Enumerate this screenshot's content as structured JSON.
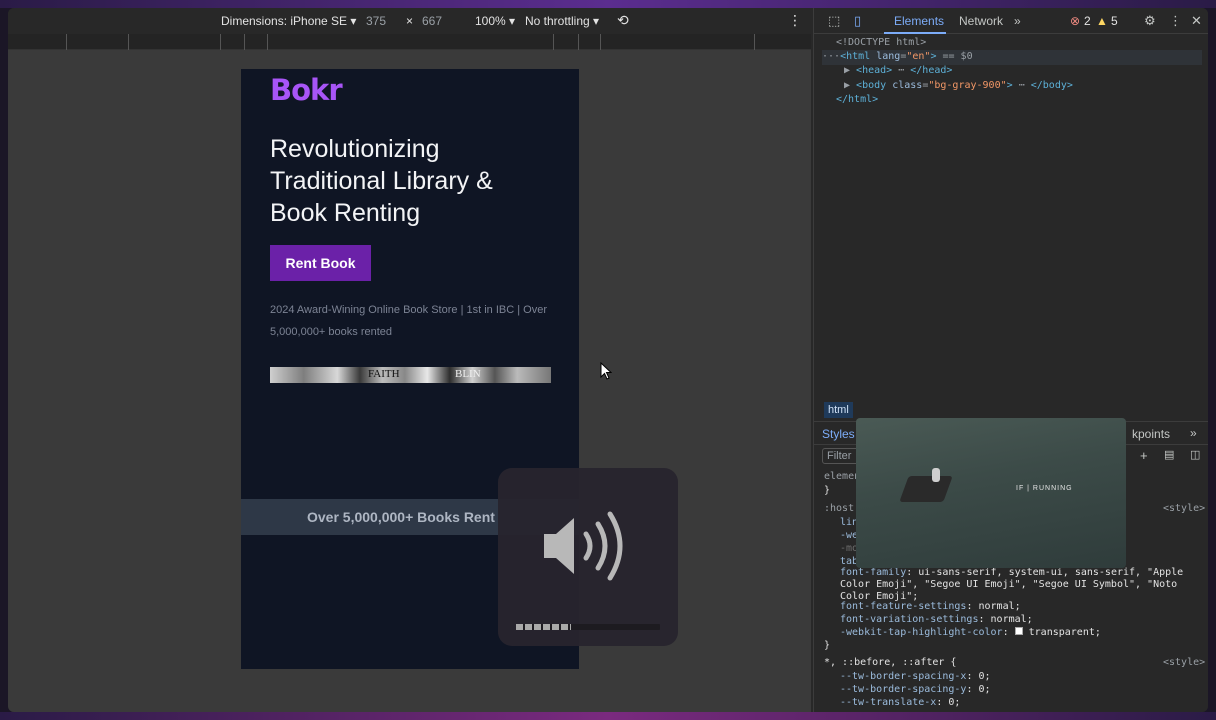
{
  "device_toolbar": {
    "dimensions_label": "Dimensions: iPhone SE",
    "width": "375",
    "times": "×",
    "height": "667",
    "zoom": "100%",
    "throttling": "No throttling"
  },
  "site": {
    "logo": "Bokr",
    "headline": "Revolutionizing Traditional Library & Book Renting",
    "cta_label": "Rent Book",
    "awards_text": "2024 Award-Wining Online Book Store  |  1st in IBC  |  Over 5,000,000+ books rented",
    "book_strip_text_1": "FAITH",
    "book_strip_text_2": "BLIN",
    "banner_text": "Over 5,000,000+ Books Rent"
  },
  "devtools": {
    "tabs": [
      "Elements",
      "Network"
    ],
    "more": "»",
    "error_count": "2",
    "warning_count": "5",
    "dom": {
      "doctype": "<!DOCTYPE html>",
      "html_open_tag": "html",
      "html_attr_name": "lang",
      "html_attr_value": "\"en\"",
      "selected_marker": " == $0",
      "head_line": "<head>",
      "head_close": "</head>",
      "body_tag": "body",
      "body_attr_name": "class",
      "body_attr_value": "\"bg-gray-900\"",
      "body_close": "</body>",
      "html_close": "</html>"
    },
    "breadcrumb": "html",
    "styles_tab": "Styles",
    "breakpoints_tab_partial": "kpoints",
    "filter_placeholder": "Filter",
    "video_label": "IF | RUNNING",
    "styles": {
      "element_partial": "element",
      "host_partial": ":host,",
      "style_source": "<style>",
      "props_partial": [
        "line",
        "-web",
        "-moz",
        "tab-"
      ],
      "font_family_prop": "font-family",
      "font_family_val": "ui-sans-serif, system-ui, sans-serif, \"Apple Color Emoji\", \"Segoe UI Emoji\", \"Segoe UI Symbol\", \"Noto Color Emoji\";",
      "font_feature_prop": "font-feature-settings",
      "font_feature_val": "normal;",
      "font_variation_prop": "font-variation-settings",
      "font_variation_val": "normal;",
      "tap_prop": "-webkit-tap-highlight-color",
      "tap_val": "transparent;",
      "universal_selector": "*, ::before, ::after {",
      "tw_x_prop": "--tw-border-spacing-x",
      "tw_y_prop": "--tw-border-spacing-y",
      "tw_translate_prop": "--tw-translate-x",
      "zero_val": "0;"
    }
  }
}
